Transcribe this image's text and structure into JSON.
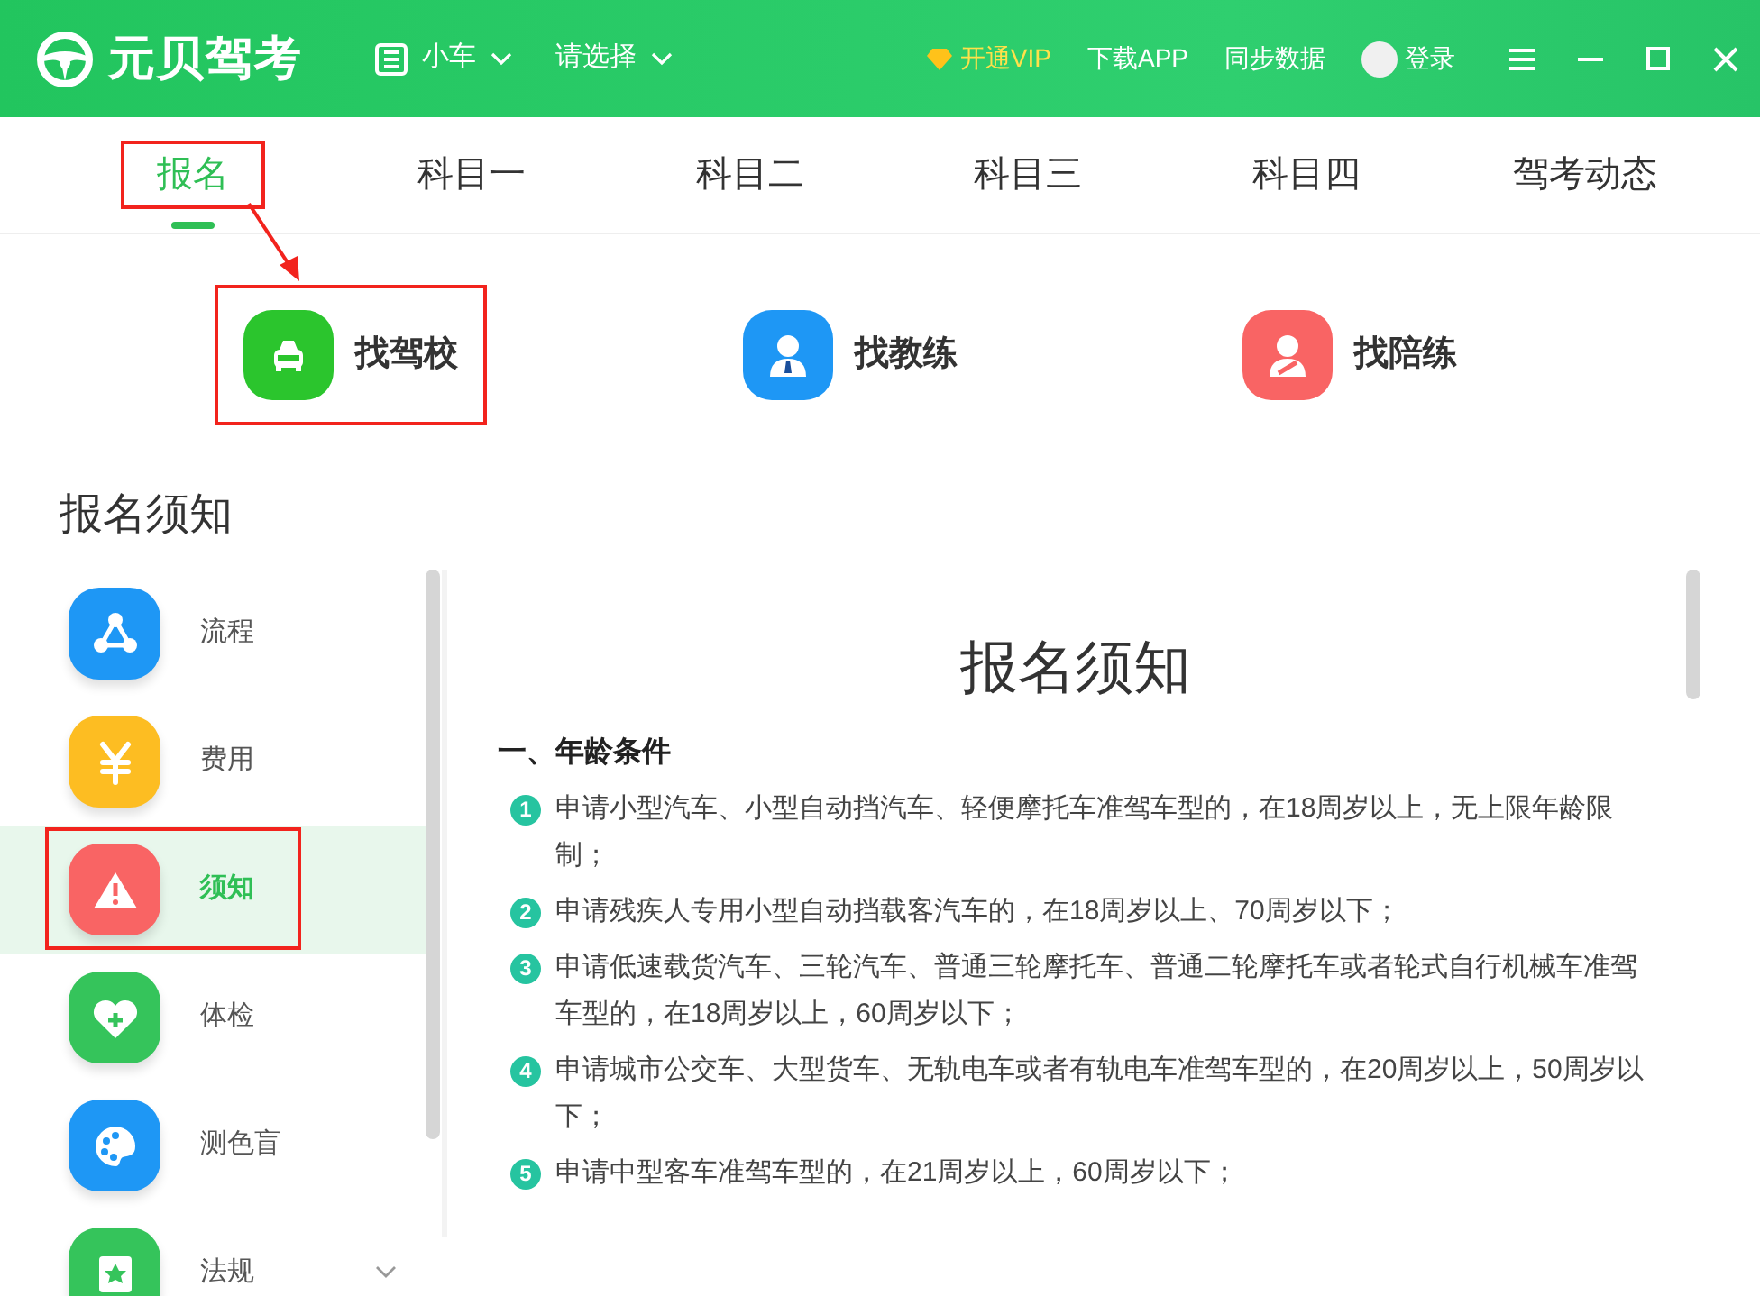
{
  "header": {
    "logo_text": "元贝驾考",
    "car_type": "小车",
    "selector": "请选择",
    "vip": "开通VIP",
    "download": "下载APP",
    "sync": "同步数据",
    "login": "登录"
  },
  "tabs": [
    {
      "label": "报名",
      "selected": true,
      "marked": true
    },
    {
      "label": "科目一",
      "selected": false,
      "marked": false
    },
    {
      "label": "科目二",
      "selected": false,
      "marked": false
    },
    {
      "label": "科目三",
      "selected": false,
      "marked": false
    },
    {
      "label": "科目四",
      "selected": false,
      "marked": false
    },
    {
      "label": "驾考动态",
      "selected": false,
      "marked": false
    }
  ],
  "quick_links": [
    {
      "label": "找驾校",
      "kind": "school",
      "marked": true
    },
    {
      "label": "找教练",
      "kind": "coach",
      "marked": false
    },
    {
      "label": "找陪练",
      "kind": "partner",
      "marked": false
    }
  ],
  "section_title": "报名须知",
  "sidebar": {
    "items": [
      {
        "label": "流程",
        "kind": "process",
        "selected": false,
        "marked": false
      },
      {
        "label": "费用",
        "kind": "fee",
        "selected": false,
        "marked": false
      },
      {
        "label": "须知",
        "kind": "notice",
        "selected": true,
        "marked": true
      },
      {
        "label": "体检",
        "kind": "health",
        "selected": false,
        "marked": false
      },
      {
        "label": "测色盲",
        "kind": "color",
        "selected": false,
        "marked": false
      },
      {
        "label": "法规",
        "kind": "law",
        "selected": false,
        "marked": false
      }
    ]
  },
  "article": {
    "title": "报名须知",
    "heading": "一、年龄条件",
    "items": [
      {
        "number": "1",
        "text": "申请小型汽车、小型自动挡汽车、轻便摩托车准驾车型的，在18周岁以上，无上限年龄限制；"
      },
      {
        "number": "2",
        "text": "申请残疾人专用小型自动挡载客汽车的，在18周岁以上、70周岁以下；"
      },
      {
        "number": "3",
        "text": "申请低速载货汽车、三轮汽车、普通三轮摩托车、普通二轮摩托车或者轮式自行机械车准驾车型的，在18周岁以上，60周岁以下；"
      },
      {
        "number": "4",
        "text": "申请城市公交车、大型货车、无轨电车或者有轨电车准驾车型的，在20周岁以上，50周岁以下；"
      },
      {
        "number": "5",
        "text": "申请中型客车准驾车型的，在21周岁以上，60周岁以下；"
      }
    ]
  }
}
